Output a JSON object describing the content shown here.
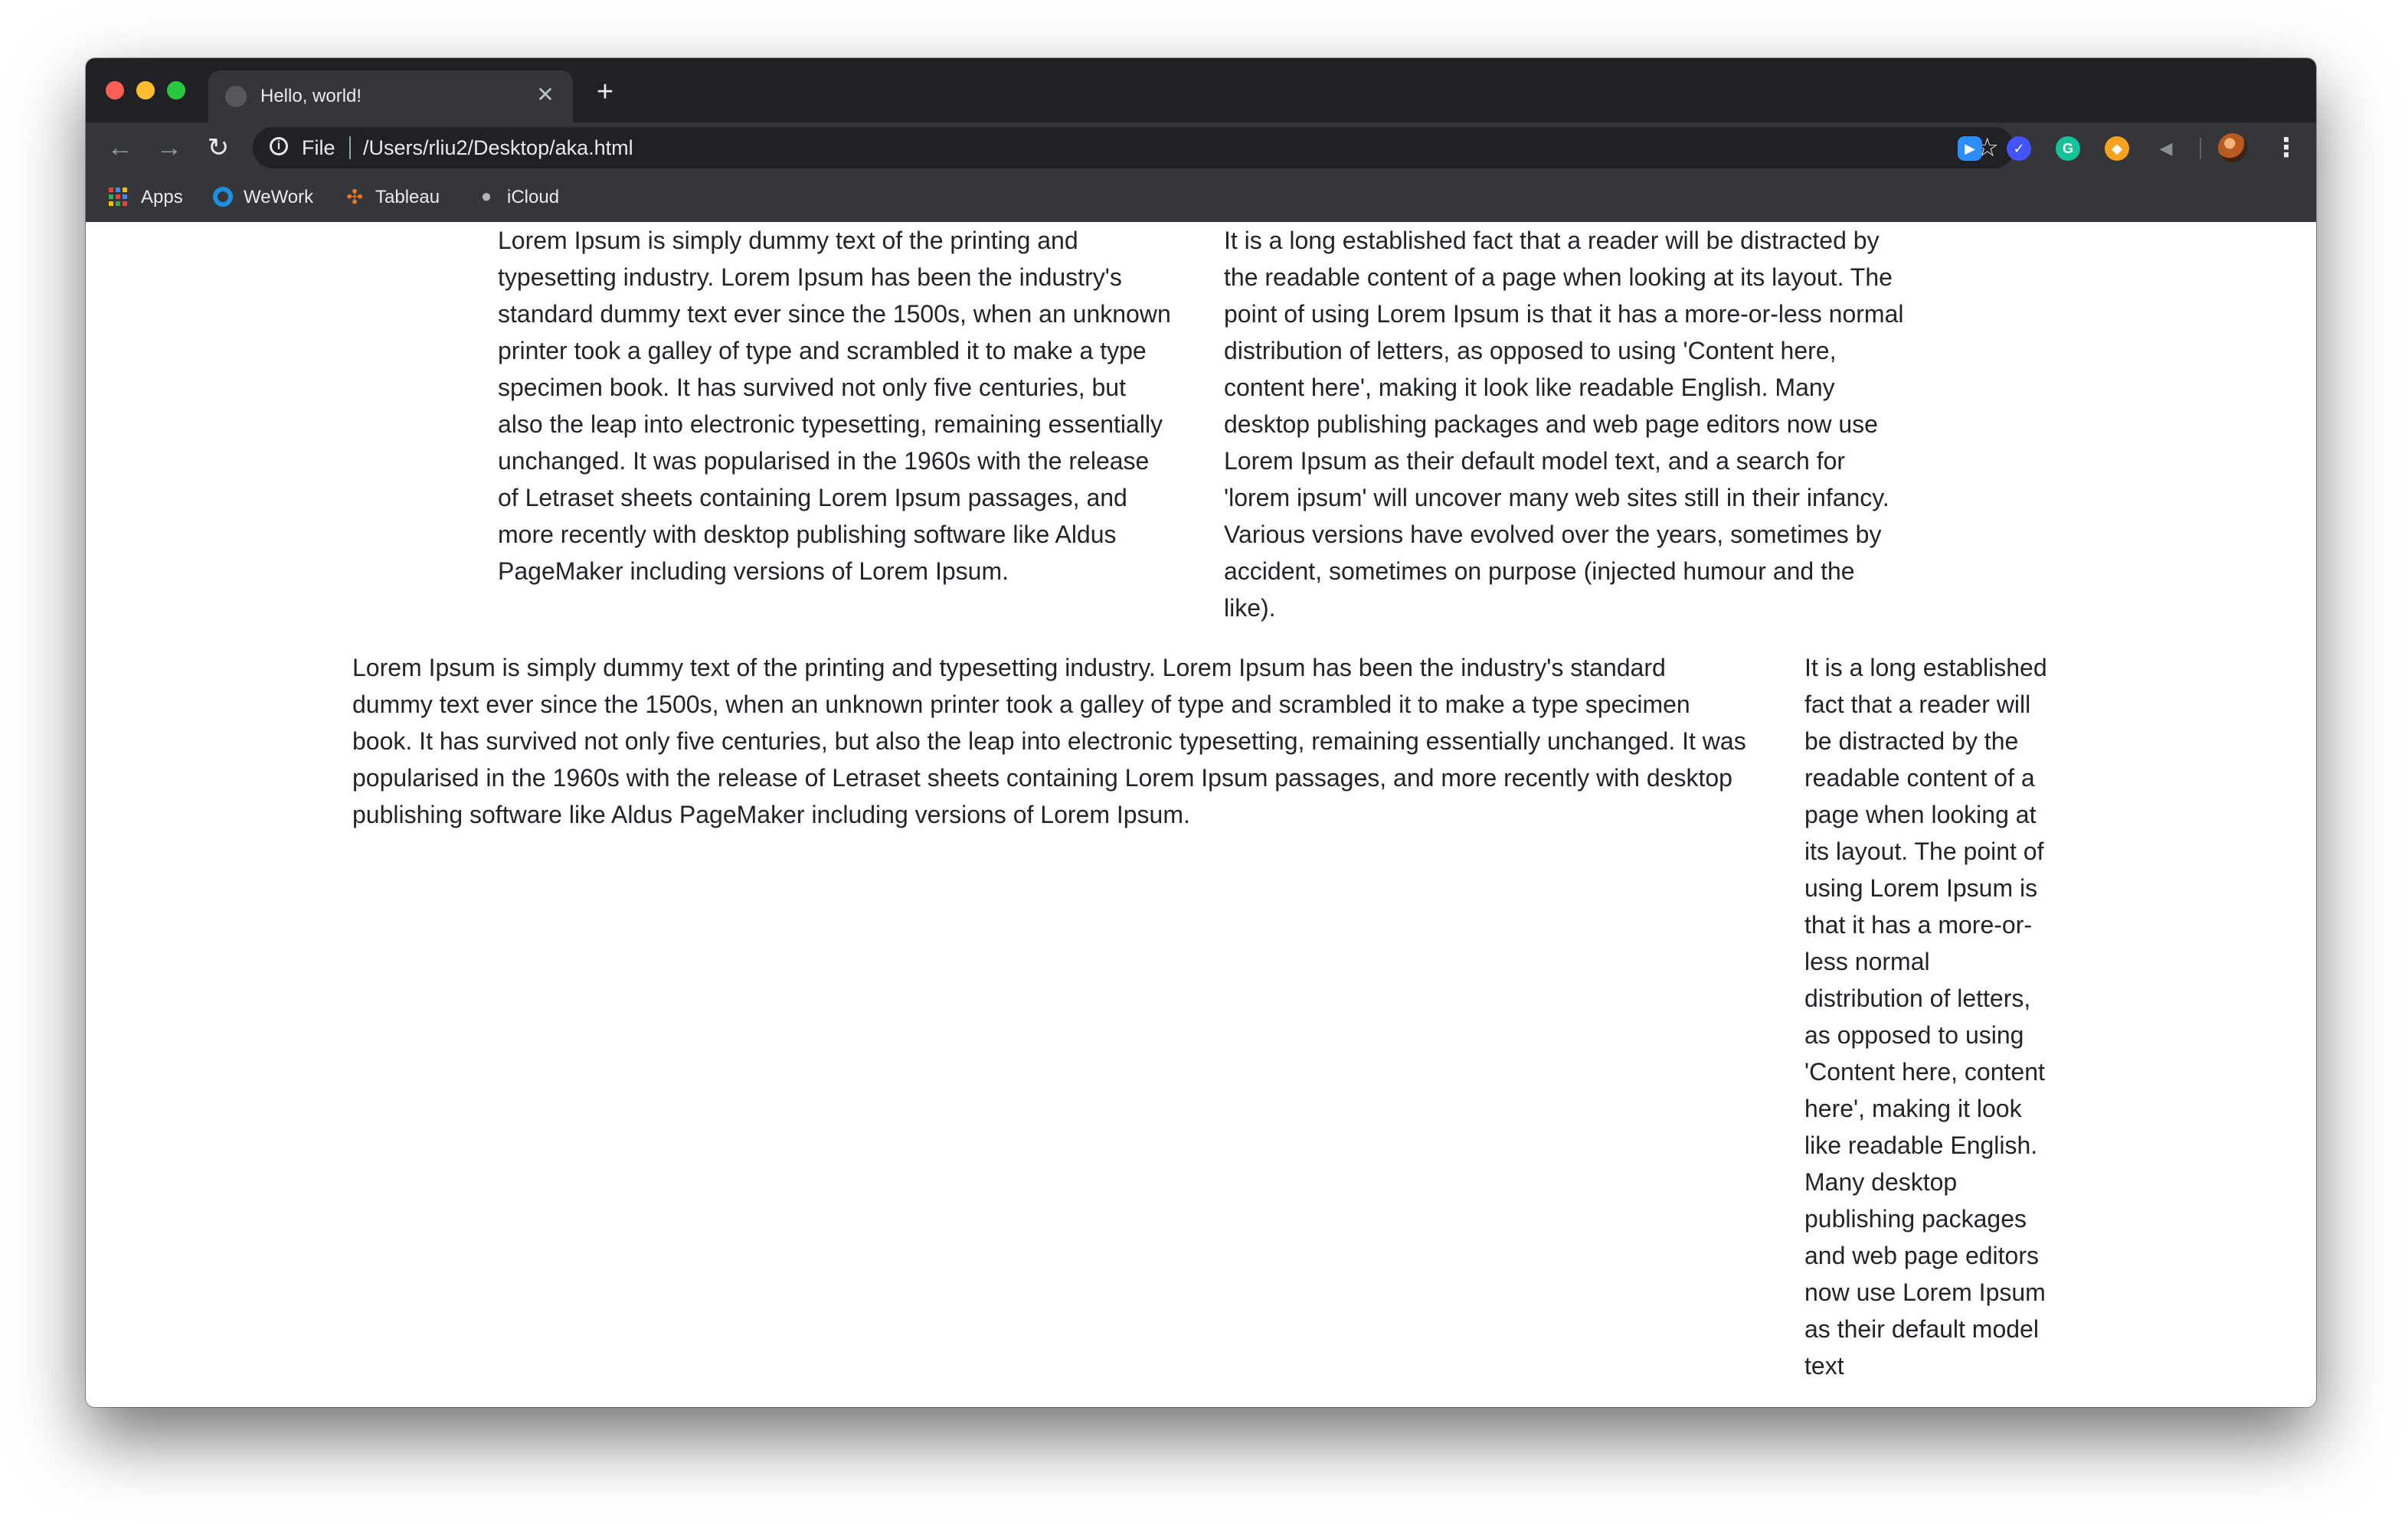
{
  "browser": {
    "tab_title": "Hello, world!",
    "tab_close": "✕",
    "new_tab": "+",
    "nav": {
      "back": "←",
      "forward": "→",
      "reload": "↻"
    },
    "omnibox": {
      "info": "i",
      "scheme": "File",
      "url": "/Users/rliu2/Desktop/aka.html"
    },
    "star": "☆",
    "extensions": [
      "zoom-icon",
      "vpn-icon",
      "grammarly-icon",
      "orange-extension-icon",
      "speaker-icon"
    ],
    "menu": "⋮",
    "bookmarks": [
      {
        "label": "Apps",
        "icon": "apps-grid-icon"
      },
      {
        "label": "WeWork",
        "icon": "wework-icon"
      },
      {
        "label": "Tableau",
        "icon": "tableau-icon"
      },
      {
        "label": "iCloud",
        "icon": "apple-icon"
      }
    ]
  },
  "page": {
    "paragraphs": [
      "Lorem Ipsum is simply dummy text of the printing and typesetting industry. Lorem Ipsum has been the industry's standard dummy text ever since the 1500s, when an unknown printer took a galley of type and scrambled it to make a type specimen book. It has survived not only five centuries, but also the leap into electronic typesetting, remaining essentially unchanged. It was popularised in the 1960s with the release of Letraset sheets containing Lorem Ipsum passages, and more recently with desktop publishing software like Aldus PageMaker including versions of Lorem Ipsum.",
      "It is a long established fact that a reader will be distracted by the readable content of a page when looking at its layout. The point of using Lorem Ipsum is that it has a more-or-less normal distribution of letters, as opposed to using 'Content here, content here', making it look like readable English. Many desktop publishing packages and web page editors now use Lorem Ipsum as their default model text, and a search for 'lorem ipsum' will uncover many web sites still in their infancy. Various versions have evolved over the years, sometimes by accident, sometimes on purpose (injected humour and the like).",
      "Lorem Ipsum is simply dummy text of the printing and typesetting industry. Lorem Ipsum has been the industry's standard dummy text ever since the 1500s, when an unknown printer took a galley of type and scrambled it to make a type specimen book. It has survived not only five centuries, but also the leap into electronic typesetting, remaining essentially unchanged. It was popularised in the 1960s with the release of Letraset sheets containing Lorem Ipsum passages, and more recently with desktop publishing software like Aldus PageMaker including versions of Lorem Ipsum.",
      "It is a long established fact that a reader will be distracted by the readable content of a page when looking at its layout. The point of using Lorem Ipsum is that it has a more-or-less normal distribution of letters, as opposed to using 'Content here, content here', making it look like readable English. Many desktop publishing packages and web page editors now use Lorem Ipsum as their default model text"
    ]
  },
  "colors": {
    "tab_strip": "#202124",
    "toolbar": "#35363a",
    "text": "#212529"
  }
}
